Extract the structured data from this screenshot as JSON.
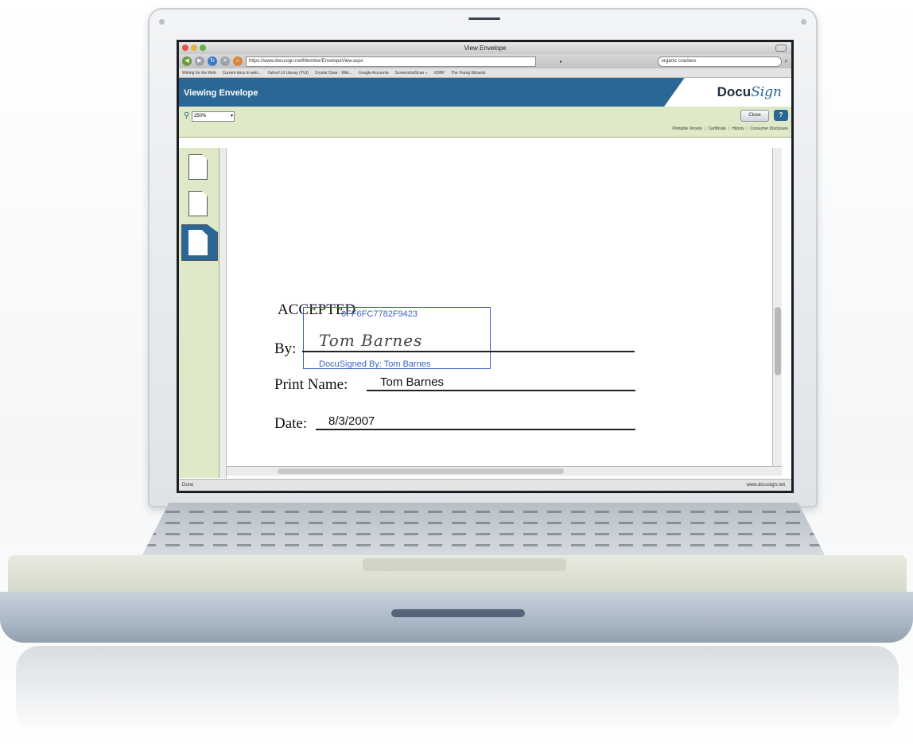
{
  "window": {
    "title": "View Envelope"
  },
  "browser": {
    "url": "https://www.docusign.net/Member/EnvelopeView.aspx",
    "search_text": "organic crackers",
    "bookmarks": [
      "Writing for the Web",
      "Current docs in web...",
      "Yahoo! UI Library (YUI)",
      "Crystal Clear - Wiki...",
      "Google Accounts",
      "ScreenshotScan »",
      "XDBP",
      "The Young Wizards"
    ]
  },
  "app": {
    "header_title": "Viewing Envelope",
    "logo_prefix": "Docu",
    "logo_script": "Sign",
    "zoom_value": "250%",
    "close_label": "Close",
    "help_label": "?",
    "toolbar_links": [
      "Printable Version",
      "Certificate",
      "History",
      "Consumer Disclosure"
    ]
  },
  "document": {
    "accepted_label": "ACCEPTED",
    "envelope_code": "0FF6FC7782F9423",
    "by_label": "By:",
    "signature": "Tom Barnes",
    "signed_by": "DocuSigned By: Tom Barnes",
    "print_name_label": "Print Name:",
    "print_name_value": "Tom Barnes",
    "date_label": "Date:",
    "date_value": "8/3/2007"
  },
  "status": {
    "left": "Done",
    "right": "www.docusign.net"
  },
  "colors": {
    "header_blue": "#2b6795",
    "toolbar_green": "#dfe9c8",
    "signature_blue": "#3a63c9"
  }
}
